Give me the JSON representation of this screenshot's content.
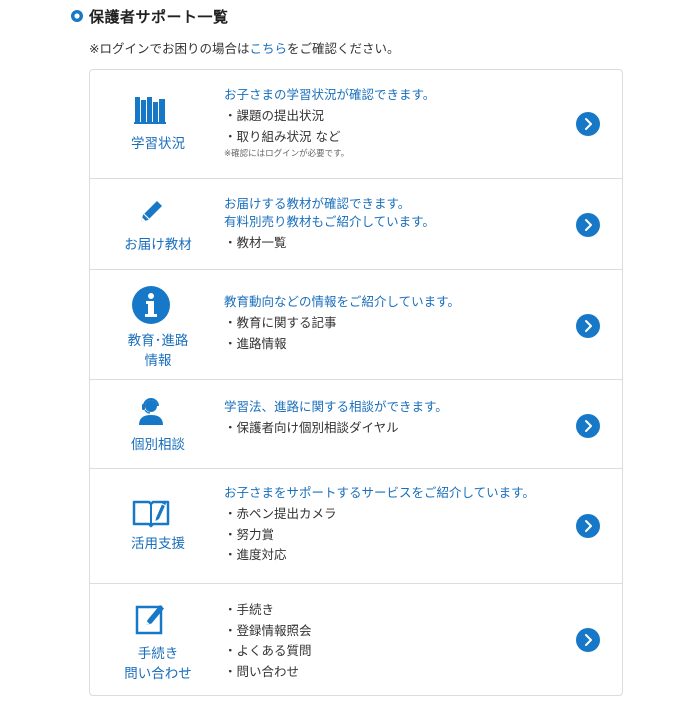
{
  "header": {
    "title": "保護者サポート一覧",
    "icon": "circle-bullet-icon"
  },
  "note": {
    "prefix": "※ログインでお困りの場合は",
    "link": "こちら",
    "suffix": "をご確認ください。"
  },
  "accent_color": "#1678c7",
  "rows": [
    {
      "icon": "books-icon",
      "label": "学習状況",
      "headline": "お子さまの学習状況が確認できます。",
      "items": [
        "・課題の提出状況",
        "・取り組み状況 など"
      ],
      "note": "※確認にはログインが必要です。"
    },
    {
      "icon": "pencil-icon",
      "label": "お届け教材",
      "headline": "お届けする教材が確認できます。\n有料別売り教材もご紹介しています。",
      "items": [
        "・教材一覧"
      ]
    },
    {
      "icon": "info-icon",
      "label": "教育･進路\n情報",
      "headline": "教育動向などの情報をご紹介しています。",
      "items": [
        "・教育に関する記事",
        "・進路情報"
      ]
    },
    {
      "icon": "headset-person-icon",
      "label": "個別相談",
      "headline": "学習法、進路に関する相談ができます。",
      "items": [
        "・保護者向け個別相談ダイヤル"
      ]
    },
    {
      "icon": "book-pen-icon",
      "label": "活用支援",
      "headline": "お子さまをサポートするサービスをご紹介しています。",
      "items": [
        "・赤ペン提出カメラ",
        "・努力賞",
        "・進度対応"
      ]
    },
    {
      "icon": "form-edit-icon",
      "label": "手続き\n問い合わせ",
      "headline": "",
      "items": [
        "・手続き",
        "・登録情報照会",
        "・よくある質問",
        "・問い合わせ"
      ]
    }
  ]
}
